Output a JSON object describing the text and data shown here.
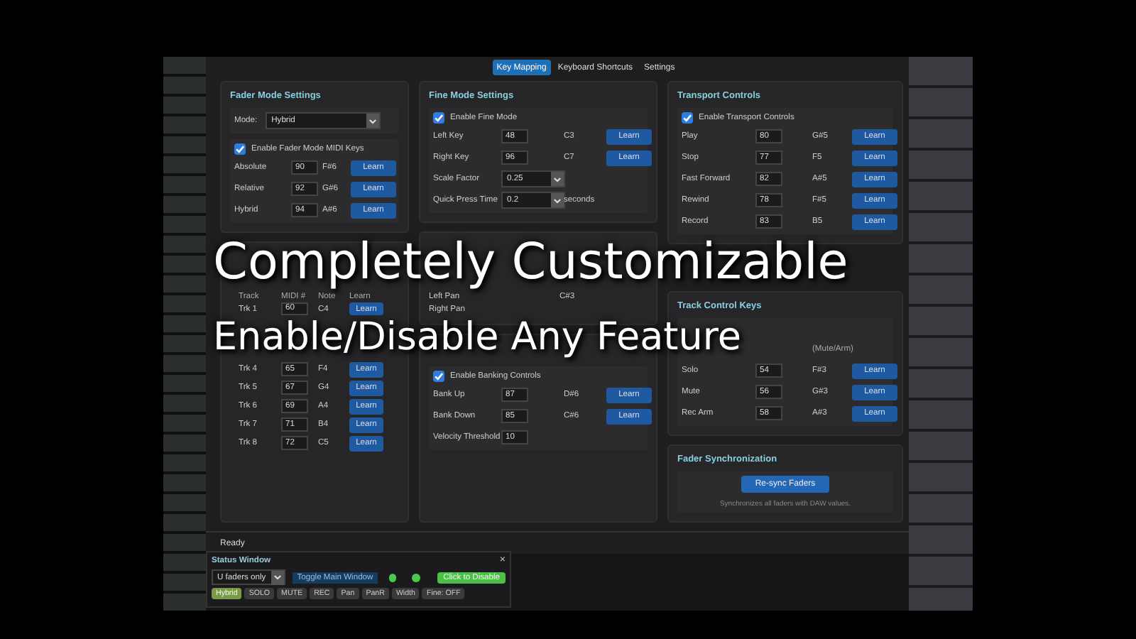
{
  "tabs": [
    {
      "label": "Key Mapping",
      "selected": true
    },
    {
      "label": "Keyboard Shortcuts",
      "selected": false
    },
    {
      "label": "Settings",
      "selected": false
    }
  ],
  "fader_mode": {
    "title": "Fader Mode Settings",
    "mode_label": "Mode:",
    "mode_value": "Hybrid",
    "enable": {
      "label": "Enable Fader Mode MIDI Keys",
      "checked": true
    },
    "rows": [
      {
        "label": "Absolute",
        "midi": "90",
        "note": "F#6",
        "button": "Learn"
      },
      {
        "label": "Relative",
        "midi": "92",
        "note": "G#6",
        "button": "Learn"
      },
      {
        "label": "Hybrid",
        "midi": "94",
        "note": "A#6",
        "button": "Learn"
      }
    ]
  },
  "track_mapping": {
    "columns": [
      "Track",
      "MIDI #",
      "Note",
      "Learn"
    ],
    "rows": [
      {
        "track": "Trk 1",
        "midi": "60",
        "note": "C4",
        "button": "Learn"
      },
      {
        "track": "Trk 4",
        "midi": "65",
        "note": "F4",
        "button": "Learn"
      },
      {
        "track": "Trk 5",
        "midi": "67",
        "note": "G4",
        "button": "Learn"
      },
      {
        "track": "Trk 6",
        "midi": "69",
        "note": "A4",
        "button": "Learn"
      },
      {
        "track": "Trk 7",
        "midi": "71",
        "note": "B4",
        "button": "Learn"
      },
      {
        "track": "Trk 8",
        "midi": "72",
        "note": "C5",
        "button": "Learn"
      }
    ]
  },
  "fine_mode": {
    "title": "Fine Mode Settings",
    "enable": {
      "label": "Enable Fine Mode",
      "checked": true
    },
    "rows": [
      {
        "kind": "key",
        "label": "Left Key",
        "midi": "48",
        "note": "C3",
        "button": "Learn"
      },
      {
        "kind": "key",
        "label": "Right Key",
        "midi": "96",
        "note": "C7",
        "button": "Learn"
      },
      {
        "kind": "select",
        "label": "Scale Factor",
        "value": "0.25"
      },
      {
        "kind": "select",
        "label": "Quick Press Time",
        "value": "0.2",
        "unit": "seconds"
      }
    ]
  },
  "pan": {
    "rows": [
      {
        "label": "Left Pan",
        "note": "C#3"
      },
      {
        "label": "Right Pan"
      }
    ]
  },
  "banking": {
    "enable": {
      "label": "Enable Banking Controls",
      "checked": true
    },
    "rows": [
      {
        "kind": "key",
        "label": "Bank Up",
        "midi": "87",
        "note": "D#6",
        "button": "Learn"
      },
      {
        "kind": "key",
        "label": "Bank Down",
        "midi": "85",
        "note": "C#6",
        "button": "Learn"
      },
      {
        "kind": "value",
        "label": "Velocity Threshold",
        "midi": "10"
      }
    ]
  },
  "transport": {
    "title": "Transport Controls",
    "enable": {
      "label": "Enable Transport Controls",
      "checked": true
    },
    "rows": [
      {
        "label": "Play",
        "midi": "80",
        "note": "G#5",
        "button": "Learn"
      },
      {
        "label": "Stop",
        "midi": "77",
        "note": "F5",
        "button": "Learn"
      },
      {
        "label": "Fast Forward",
        "midi": "82",
        "note": "A#5",
        "button": "Learn"
      },
      {
        "label": "Rewind",
        "midi": "78",
        "note": "F#5",
        "button": "Learn"
      },
      {
        "label": "Record",
        "midi": "83",
        "note": "B5",
        "button": "Learn"
      }
    ]
  },
  "track_control": {
    "title": "Track Control Keys",
    "column_3": "(Mute/Arm)",
    "rows": [
      {
        "label": "Solo",
        "midi": "54",
        "note": "F#3",
        "button": "Learn"
      },
      {
        "label": "Mute",
        "midi": "56",
        "note": "G#3",
        "button": "Learn"
      },
      {
        "label": "Rec Arm",
        "midi": "58",
        "note": "A#3",
        "button": "Learn"
      }
    ]
  },
  "fader_sync": {
    "title": "Fader Synchronization",
    "button": "Re-sync Faders",
    "note": "Synchronizes all faders with DAW values."
  },
  "status_bar": "Ready",
  "status_window": {
    "title": "Status Window",
    "close": "×",
    "filter": "U faders only",
    "toggle": "Toggle Main Window",
    "leds": [
      {
        "on": true
      },
      {
        "on": true
      }
    ],
    "disable": "Click to Disable",
    "modes": [
      {
        "label": "Hybrid",
        "selected": true
      },
      {
        "label": "SOLO",
        "selected": false
      },
      {
        "label": "MUTE",
        "selected": false
      },
      {
        "label": "REC",
        "selected": false
      },
      {
        "label": "Pan",
        "selected": false
      },
      {
        "label": "PanR",
        "selected": false
      },
      {
        "label": "Width",
        "selected": false
      },
      {
        "label": "Fine: OFF",
        "selected": false
      }
    ]
  },
  "caption": {
    "line_1": "Completely Customizable",
    "line_2": "Enable/Disable Any Feature"
  }
}
